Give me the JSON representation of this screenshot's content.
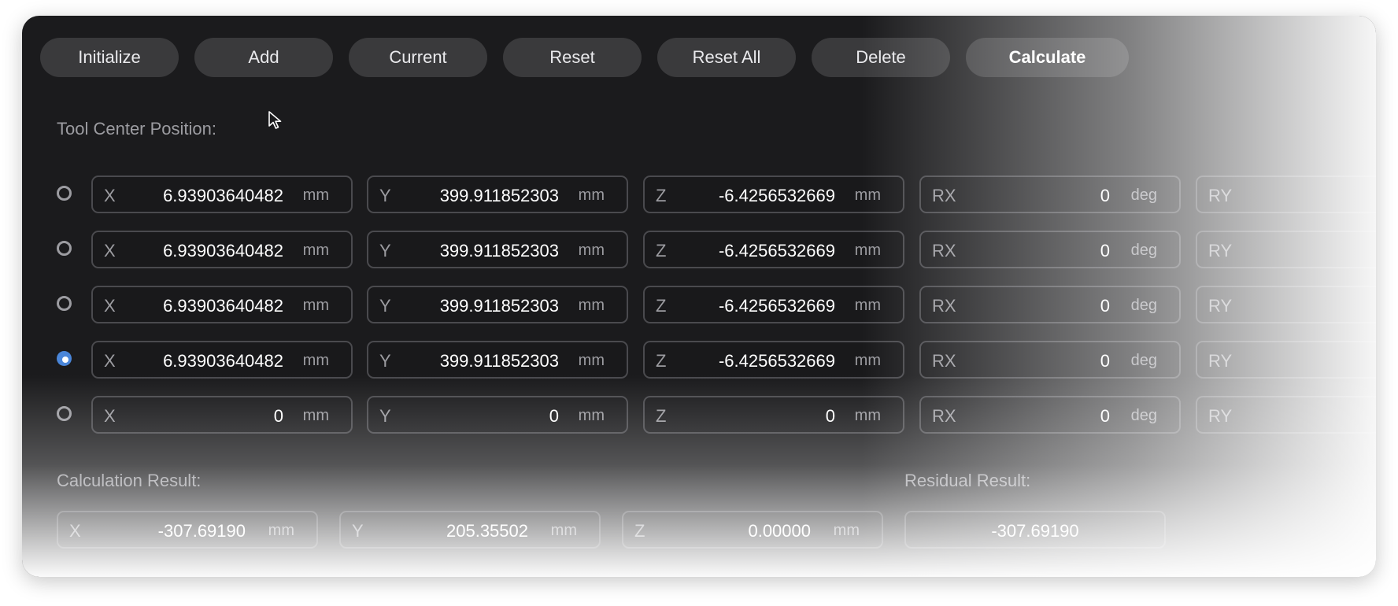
{
  "toolbar": {
    "buttons": [
      "Initialize",
      "Add",
      "Current",
      "Reset",
      "Reset All",
      "Delete"
    ],
    "calculate_label": "Calculate"
  },
  "tool_center": {
    "label": "Tool Center Position:",
    "selected_row": 3,
    "rows": [
      {
        "x": "6.93903640482",
        "y": "399.911852303",
        "z": "-6.4256532669",
        "rx": "0",
        "ry": ""
      },
      {
        "x": "6.93903640482",
        "y": "399.911852303",
        "z": "-6.4256532669",
        "rx": "0",
        "ry": ""
      },
      {
        "x": "6.93903640482",
        "y": "399.911852303",
        "z": "-6.4256532669",
        "rx": "0",
        "ry": ""
      },
      {
        "x": "6.93903640482",
        "y": "399.911852303",
        "z": "-6.4256532669",
        "rx": "0",
        "ry": ""
      },
      {
        "x": "0",
        "y": "0",
        "z": "0",
        "rx": "0",
        "ry": ""
      }
    ]
  },
  "labels": {
    "x": "X",
    "y": "Y",
    "z": "Z",
    "rx": "RX",
    "ry": "RY"
  },
  "units": {
    "mm": "mm",
    "deg": "deg"
  },
  "calculation": {
    "label": "Calculation Result:",
    "x": "-307.69190",
    "y": "205.35502",
    "z": "0.00000"
  },
  "residual": {
    "label": "Residual Result:",
    "value": "-307.69190"
  },
  "colors": {
    "panel_bg": "#1b1b1d",
    "button_bg": "#3a3a3c",
    "field_border": "#4a4a4e",
    "radio_checked": "#4a86d9"
  }
}
